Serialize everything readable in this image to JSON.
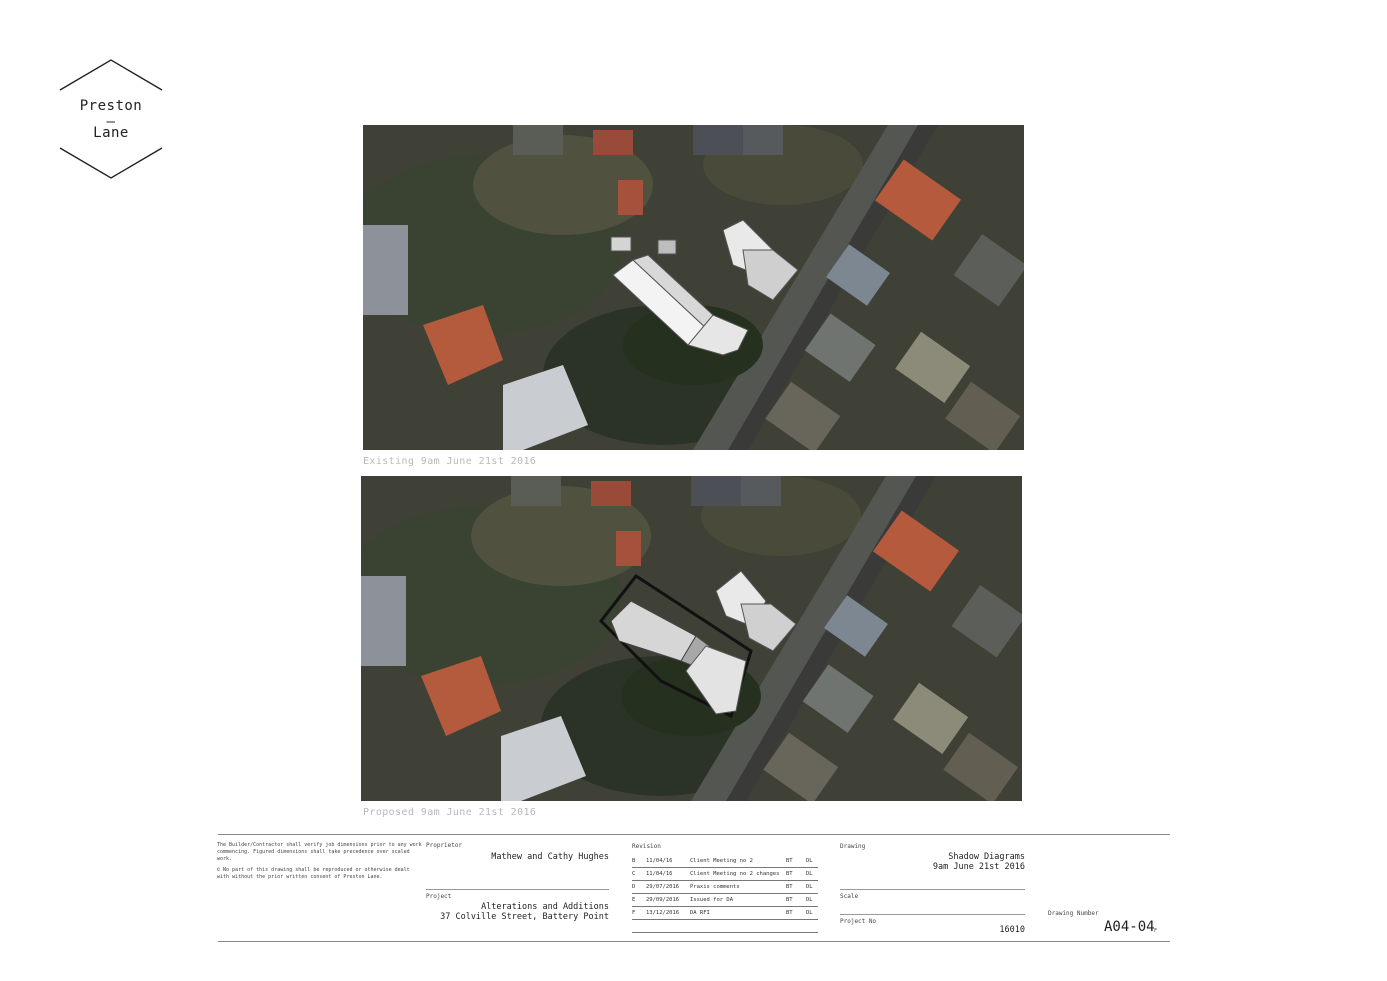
{
  "logo": {
    "line1": "Preston",
    "dash": "—",
    "line2": "Lane"
  },
  "images": [
    {
      "caption": "Existing 9am June 21st 2016"
    },
    {
      "caption": "Proposed 9am June 21st 2016"
    }
  ],
  "title_block": {
    "disclaimer": "The Builder/Contractor shall verify job dimensions prior to any work commencing. Figured dimensions shall take precedence over scaled work.",
    "copyright": "© No part of this drawing shall be reproduced or otherwise dealt with without the prior written consent of Preston Lane.",
    "proprietor_label": "Proprietor",
    "proprietor": "Mathew and Cathy Hughes",
    "project_label": "Project",
    "project_line1": "Alterations and Additions",
    "project_line2": "37 Colville Street, Battery Point",
    "revision_label": "Revision",
    "revisions": [
      {
        "rev": "B",
        "date": "11/04/16",
        "desc": "Client Meeting no 2",
        "by": "BT",
        "chk": "DL"
      },
      {
        "rev": "C",
        "date": "11/04/16",
        "desc": "Client Meeting no 2 changes",
        "by": "BT",
        "chk": "DL"
      },
      {
        "rev": "D",
        "date": "29/07/2016",
        "desc": "Praxis comments",
        "by": "BT",
        "chk": "DL"
      },
      {
        "rev": "E",
        "date": "29/09/2016",
        "desc": "Issued for DA",
        "by": "BT",
        "chk": "DL"
      },
      {
        "rev": "F",
        "date": "13/12/2016",
        "desc": "DA RFI",
        "by": "BT",
        "chk": "DL"
      }
    ],
    "drawing_label": "Drawing",
    "drawing_line1": "Shadow Diagrams",
    "drawing_line2": "9am June 21st 2016",
    "scale_label": "Scale",
    "project_no_label": "Project No",
    "project_no": "16010",
    "drawing_number_label": "Drawing Number",
    "drawing_number": "A04-04",
    "revision_code": "F"
  }
}
